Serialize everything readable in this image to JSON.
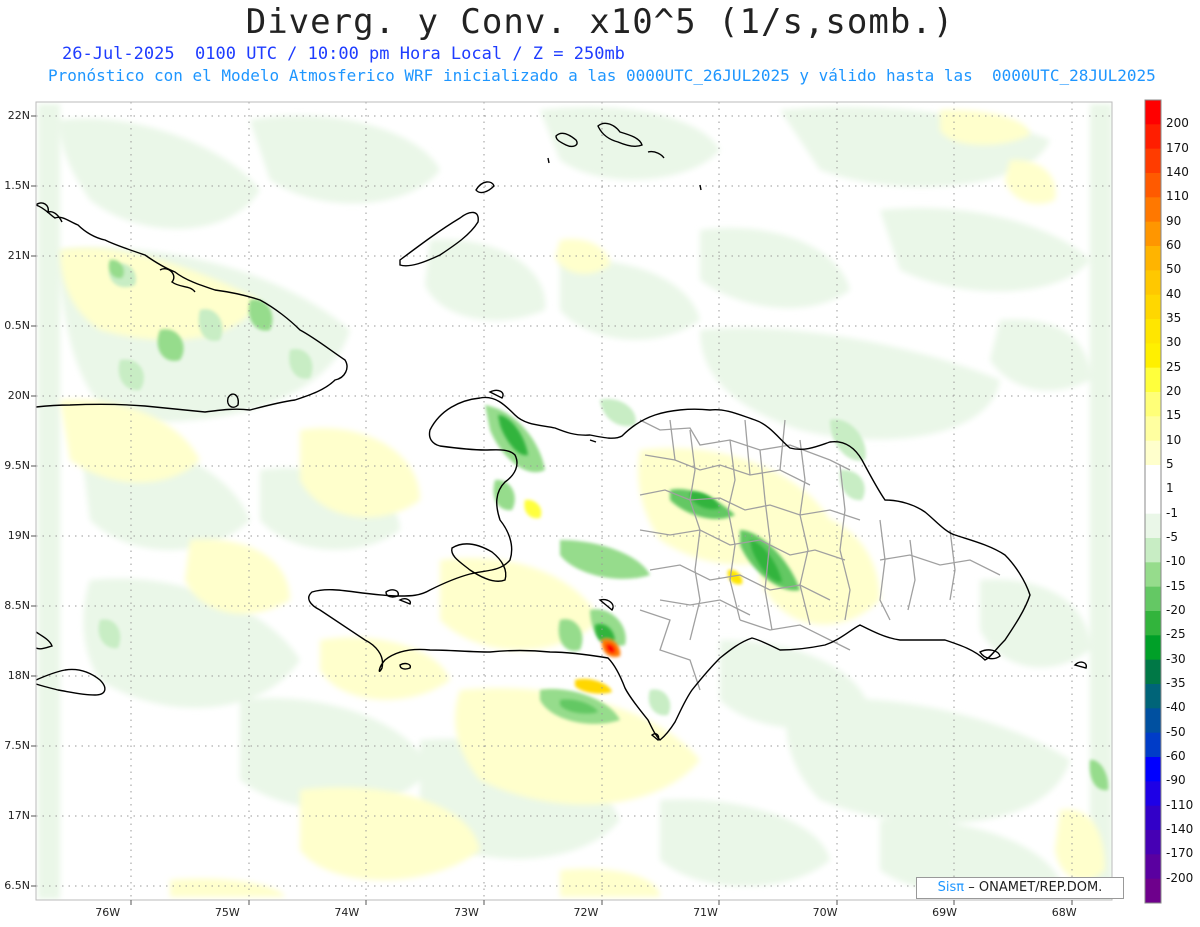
{
  "header": {
    "title": "Diverg. y Conv. x10^5 (1/s,somb.)",
    "subtitle1": "26-Jul-2025  0100 UTC / 10:00 pm Hora Local / Z = 250mb",
    "subtitle2": "Pronóstico con el Modelo Atmosferico WRF inicializado a las 0000UTC_26JUL2025 y válido hasta las  0000UTC_28JUL2025"
  },
  "axes": {
    "lat_labels": [
      "22N",
      "1.5N",
      "21N",
      "0.5N",
      "20N",
      "9.5N",
      "19N",
      "8.5N",
      "18N",
      "7.5N",
      "17N",
      "6.5N"
    ],
    "lat_values": [
      22,
      21.5,
      21,
      20.5,
      20,
      19.5,
      19,
      18.5,
      18,
      17.5,
      17,
      16.5
    ],
    "lon_labels": [
      "76W",
      "75W",
      "74W",
      "73W",
      "72W",
      "71W",
      "70W",
      "69W",
      "68W"
    ],
    "lon_values": [
      -76,
      -75,
      -74,
      -73,
      -72,
      -71,
      -70,
      -69,
      -68
    ],
    "lat_range": [
      16.45,
      22.05
    ],
    "lon_range": [
      -76.6,
      -67.6
    ],
    "grid": "dotted"
  },
  "colorbar": {
    "labels": [
      "200",
      "170",
      "140",
      "110",
      "90",
      "60",
      "50",
      "40",
      "35",
      "30",
      "25",
      "20",
      "15",
      "10",
      "5",
      "1",
      "-1",
      "-5",
      "-10",
      "-15",
      "-20",
      "-25",
      "-30",
      "-35",
      "-40",
      "-50",
      "-60",
      "-90",
      "-110",
      "-140",
      "-170",
      "-200"
    ],
    "colors": [
      "#ff0000",
      "#ff1e00",
      "#ff3c00",
      "#ff5a00",
      "#ff7800",
      "#ff9600",
      "#ffb400",
      "#ffc800",
      "#ffd700",
      "#ffe600",
      "#fff000",
      "#ffff3c",
      "#ffff78",
      "#ffffa0",
      "#ffffcc",
      "#ffffff",
      "#ffffff",
      "#eaf7e8",
      "#c8edc4",
      "#96dc8c",
      "#64c864",
      "#32b43c",
      "#00a028",
      "#007846",
      "#006478",
      "#0050a0",
      "#003cc8",
      "#0000ff",
      "#1e00e6",
      "#3200c8",
      "#4600b4",
      "#5a00a0",
      "#6e008c"
    ]
  },
  "credit": {
    "brand": "Sisπ",
    "text": "– ONAMET/REP.DOM."
  },
  "colors": {
    "title": "#222222",
    "subtitle1": "#1e3cff",
    "subtitle2": "#1e96ff",
    "coast": "#000000",
    "provinces": "#a0a0a0"
  }
}
